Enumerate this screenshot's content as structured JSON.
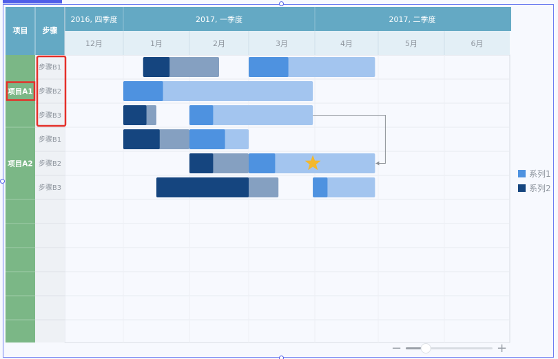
{
  "chart_data": {
    "type": "gantt",
    "header": {
      "project_col": "项目",
      "step_col": "步骤",
      "quarters": [
        "2016, 四季度",
        "2017, 一季度",
        "2017, 二季度"
      ],
      "months": [
        "12月",
        "1月",
        "2月",
        "3月",
        "4月",
        "5月",
        "6月"
      ]
    },
    "projects": [
      {
        "label": "项目A1",
        "rows": 3
      },
      {
        "label": "项目A2",
        "rows": 3
      }
    ],
    "steps": [
      "步骤B1",
      "步骤B2",
      "步骤B3",
      "步骤B1",
      "步骤B2",
      "步骤B3"
    ],
    "empty_rows": 6,
    "legend": [
      {
        "name": "系列1",
        "color": "#4e92e0"
      },
      {
        "name": "系列2",
        "color": "#15457f"
      }
    ],
    "colors": {
      "series1_done": "#4e92e0",
      "series1_rest": "#a3c5ef",
      "series2_done": "#15457f",
      "series2_rest": "#85a0c1",
      "header_bg": "#64a9c4",
      "project_bg": "#7bb786",
      "step_bg": "#eef1f5",
      "highlight": "#e5302a",
      "star": "#f3b82c",
      "link": "#8a8f96"
    },
    "tasks": [
      {
        "row": 0,
        "series": 2,
        "start": 1.3,
        "end": 2.5,
        "done": 1.7
      },
      {
        "row": 0,
        "series": 1,
        "start": 3.0,
        "end": 4.95,
        "done": 3.6
      },
      {
        "row": 1,
        "series": 1,
        "start": 1.0,
        "end": 3.97,
        "done": 1.6
      },
      {
        "row": 2,
        "series": 2,
        "start": 1.0,
        "end": 1.5,
        "done": 1.35
      },
      {
        "row": 2,
        "series": 1,
        "start": 2.0,
        "end": 3.97,
        "done": 2.4
      },
      {
        "row": 3,
        "series": 2,
        "start": 1.0,
        "end": 2.0,
        "done": 1.55
      },
      {
        "row": 3,
        "series": 1,
        "start": 2.0,
        "end": 3.0,
        "done": 2.6
      },
      {
        "row": 4,
        "series": 2,
        "start": 2.0,
        "end": 3.0,
        "done": 2.4
      },
      {
        "row": 4,
        "series": 1,
        "start": 3.0,
        "end": 4.95,
        "done": 3.4
      },
      {
        "row": 5,
        "series": 2,
        "start": 1.5,
        "end": 3.45,
        "done": 3.0
      },
      {
        "row": 5,
        "series": 1,
        "start": 3.97,
        "end": 4.95,
        "done": 4.2
      }
    ],
    "dependency": {
      "from_row": 2,
      "from_x": 3.97,
      "to_row": 4,
      "to_x": 4.95
    },
    "milestone": {
      "row": 4,
      "x": 3.97
    }
  },
  "zoom": {
    "minus": "−",
    "plus": "+",
    "value": 0.2
  }
}
